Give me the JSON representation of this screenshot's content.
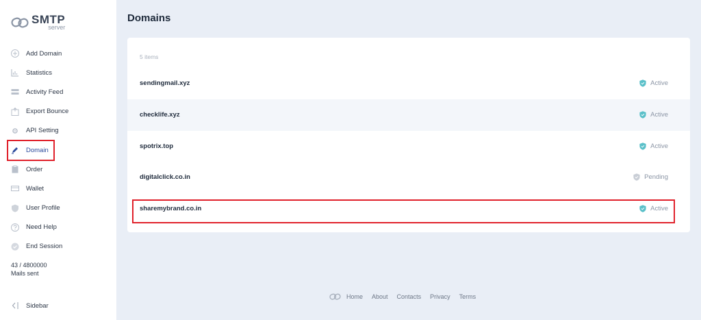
{
  "brand": {
    "title": "SMTP",
    "subtitle": "server",
    "icon": "link-logo-icon"
  },
  "sidebar": {
    "items": [
      {
        "label": "Add Domain",
        "icon": "plus-icon"
      },
      {
        "label": "Statistics",
        "icon": "chart-icon"
      },
      {
        "label": "Activity Feed",
        "icon": "list-icon"
      },
      {
        "label": "Export Bounce",
        "icon": "export-icon"
      },
      {
        "label": "API Setting",
        "icon": "gear-icon"
      },
      {
        "label": "Domain",
        "icon": "pencil-icon",
        "active": true
      },
      {
        "label": "Order",
        "icon": "clipboard-icon"
      },
      {
        "label": "Wallet",
        "icon": "wallet-icon"
      },
      {
        "label": "User Profile",
        "icon": "shield-icon"
      },
      {
        "label": "Need Help",
        "icon": "question-icon"
      },
      {
        "label": "End Session",
        "icon": "check-badge-icon"
      }
    ],
    "quota": {
      "used": "43 / 4800000",
      "label": "Mails sent"
    },
    "toggle_label": "Sidebar"
  },
  "page": {
    "title": "Domains",
    "count_label": "5 items"
  },
  "domains": [
    {
      "name": "sendingmail.xyz",
      "status": "Active"
    },
    {
      "name": "checklife.xyz",
      "status": "Active"
    },
    {
      "name": "spotrix.top",
      "status": "Active"
    },
    {
      "name": "digitalclick.co.in",
      "status": "Pending"
    },
    {
      "name": "sharemybrand.co.in",
      "status": "Active"
    }
  ],
  "footer": {
    "links": [
      "Home",
      "About",
      "Contacts",
      "Privacy",
      "Terms"
    ]
  },
  "colors": {
    "accent": "#2b4a9c",
    "active_shield": "#5bc0c9",
    "pending_shield": "#c9ced6",
    "highlight": "#e0202a"
  }
}
